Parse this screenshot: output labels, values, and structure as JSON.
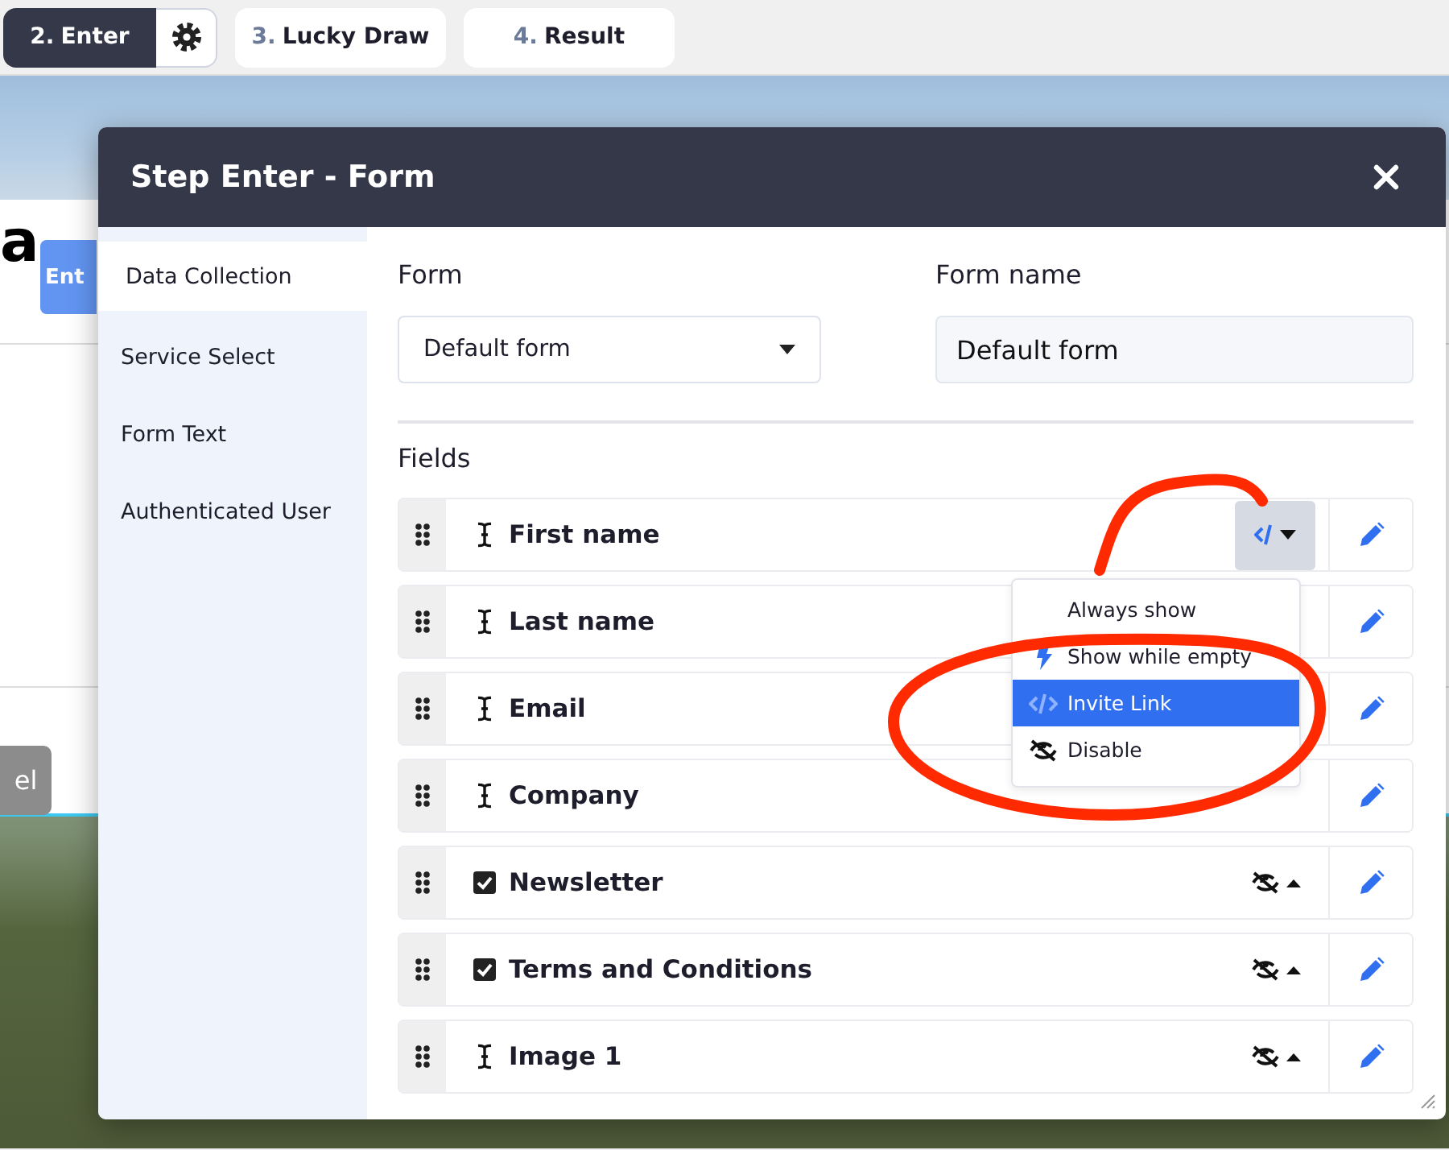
{
  "steps": [
    {
      "number": "2.",
      "label": "Enter",
      "selected": true
    },
    {
      "number": "3.",
      "label": "Lucky Draw",
      "selected": false
    },
    {
      "number": "4.",
      "label": "Result",
      "selected": false
    }
  ],
  "background_page": {
    "heading": "a",
    "enter_button": "Ent",
    "other_button": "el"
  },
  "dialog": {
    "title": "Step Enter - Form",
    "sidebar": {
      "items": [
        {
          "label": "Data Collection",
          "selected": true
        },
        {
          "label": "Service Select",
          "selected": false
        },
        {
          "label": "Form Text",
          "selected": false
        },
        {
          "label": "Authenticated User",
          "selected": false
        }
      ]
    },
    "form": {
      "label": "Form",
      "value": "Default form"
    },
    "form_name": {
      "label": "Form name",
      "value": "Default form"
    },
    "fields_title": "Fields",
    "fields": [
      {
        "kind": "text",
        "label": "First name",
        "visibility": {
          "kind": "invite-link",
          "open": true
        }
      },
      {
        "kind": "text",
        "label": "Last name"
      },
      {
        "kind": "text",
        "label": "Email"
      },
      {
        "kind": "text",
        "label": "Company"
      },
      {
        "kind": "checkbox",
        "label": "Newsletter",
        "visibility": {
          "kind": "disabled",
          "open": false
        }
      },
      {
        "kind": "checkbox",
        "label": "Terms and Conditions",
        "visibility": {
          "kind": "disabled",
          "open": false
        }
      },
      {
        "kind": "text",
        "label": "Image 1",
        "visibility": {
          "kind": "disabled",
          "open": false
        }
      }
    ],
    "visibility_menu": {
      "items": [
        {
          "label": "Always show",
          "selected": false
        },
        {
          "label": "Show while empty",
          "kind": "bolt",
          "selected": false
        },
        {
          "label": "Invite Link",
          "kind": "code",
          "selected": true
        },
        {
          "label": "Disable",
          "kind": "eye-slash",
          "selected": false
        }
      ]
    }
  }
}
